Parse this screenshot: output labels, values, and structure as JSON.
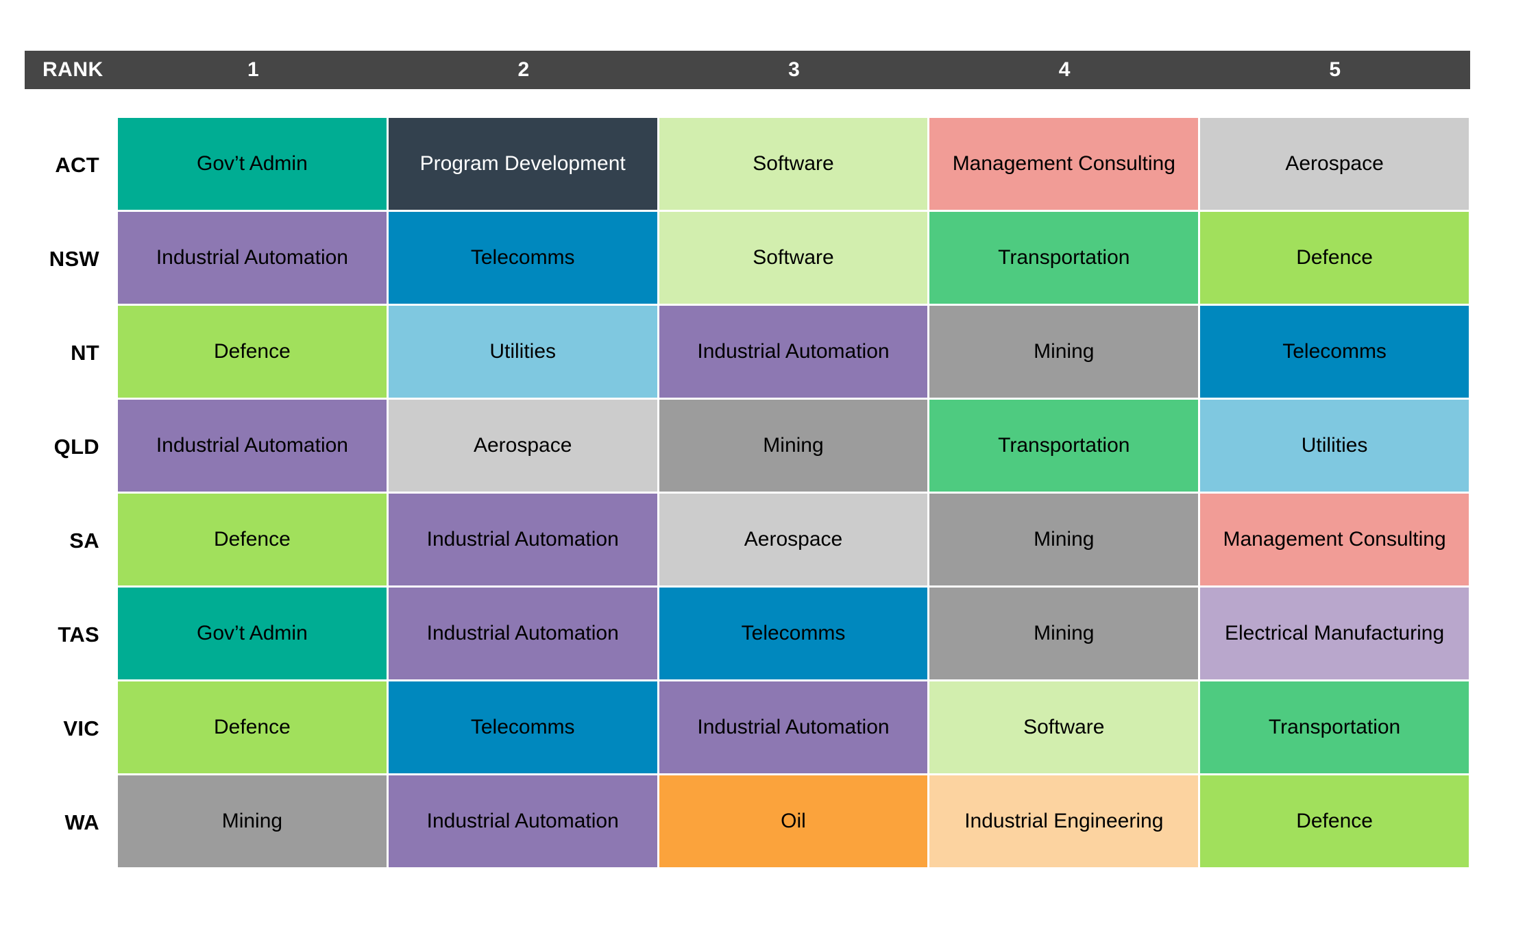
{
  "header": {
    "rank_label": "RANK",
    "columns": [
      "1",
      "2",
      "3",
      "4",
      "5"
    ],
    "background": "#464646",
    "text_color": "#ffffff"
  },
  "rows": [
    {
      "label": "ACT",
      "cells": [
        {
          "text": "Gov’t Admin",
          "color": "#00AD93",
          "text_color": "#000000"
        },
        {
          "text": "Program Development",
          "color": "#33414E",
          "text_color": "#ffffff"
        },
        {
          "text": "Software",
          "color": "#D2EEAE",
          "text_color": "#000000"
        },
        {
          "text": "Management Consulting",
          "color": "#F19C96",
          "text_color": "#000000"
        },
        {
          "text": "Aerospace",
          "color": "#CCCCCC",
          "text_color": "#000000"
        }
      ]
    },
    {
      "label": "NSW",
      "cells": [
        {
          "text": "Industrial Automation",
          "color": "#8D78B2",
          "text_color": "#000000"
        },
        {
          "text": "Telecomms",
          "color": "#0088BE",
          "text_color": "#000000"
        },
        {
          "text": "Software",
          "color": "#D2EEAE",
          "text_color": "#000000"
        },
        {
          "text": "Transportation",
          "color": "#4ECB80",
          "text_color": "#000000"
        },
        {
          "text": "Defence",
          "color": "#A1E05C",
          "text_color": "#000000"
        }
      ]
    },
    {
      "label": "NT",
      "cells": [
        {
          "text": "Defence",
          "color": "#A1E05C",
          "text_color": "#000000"
        },
        {
          "text": "Utilities",
          "color": "#7FC8E0",
          "text_color": "#000000"
        },
        {
          "text": "Industrial Automation",
          "color": "#8D78B2",
          "text_color": "#000000"
        },
        {
          "text": "Mining",
          "color": "#9C9C9C",
          "text_color": "#000000"
        },
        {
          "text": "Telecomms",
          "color": "#0088BE",
          "text_color": "#000000"
        }
      ]
    },
    {
      "label": "QLD",
      "cells": [
        {
          "text": "Industrial Automation",
          "color": "#8D78B2",
          "text_color": "#000000"
        },
        {
          "text": "Aerospace",
          "color": "#CCCCCC",
          "text_color": "#000000"
        },
        {
          "text": "Mining",
          "color": "#9C9C9C",
          "text_color": "#000000"
        },
        {
          "text": "Transportation",
          "color": "#4ECB80",
          "text_color": "#000000"
        },
        {
          "text": "Utilities",
          "color": "#7FC8E0",
          "text_color": "#000000"
        }
      ]
    },
    {
      "label": "SA",
      "cells": [
        {
          "text": "Defence",
          "color": "#A1E05C",
          "text_color": "#000000"
        },
        {
          "text": "Industrial Automation",
          "color": "#8D78B2",
          "text_color": "#000000"
        },
        {
          "text": "Aerospace",
          "color": "#CCCCCC",
          "text_color": "#000000"
        },
        {
          "text": "Mining",
          "color": "#9C9C9C",
          "text_color": "#000000"
        },
        {
          "text": "Management Consulting",
          "color": "#F19C96",
          "text_color": "#000000"
        }
      ]
    },
    {
      "label": "TAS",
      "cells": [
        {
          "text": "Gov’t Admin",
          "color": "#00AD93",
          "text_color": "#000000"
        },
        {
          "text": "Industrial Automation",
          "color": "#8D78B2",
          "text_color": "#000000"
        },
        {
          "text": "Telecomms",
          "color": "#0088BE",
          "text_color": "#000000"
        },
        {
          "text": "Mining",
          "color": "#9C9C9C",
          "text_color": "#000000"
        },
        {
          "text": "Electrical Manufacturing",
          "color": "#B9A7CC",
          "text_color": "#000000"
        }
      ]
    },
    {
      "label": "VIC",
      "cells": [
        {
          "text": "Defence",
          "color": "#A1E05C",
          "text_color": "#000000"
        },
        {
          "text": "Telecomms",
          "color": "#0088BE",
          "text_color": "#000000"
        },
        {
          "text": "Industrial Automation",
          "color": "#8D78B2",
          "text_color": "#000000"
        },
        {
          "text": "Software",
          "color": "#D2EEAE",
          "text_color": "#000000"
        },
        {
          "text": "Transportation",
          "color": "#4ECB80",
          "text_color": "#000000"
        }
      ]
    },
    {
      "label": "WA",
      "cells": [
        {
          "text": "Mining",
          "color": "#9C9C9C",
          "text_color": "#000000"
        },
        {
          "text": "Industrial Automation",
          "color": "#8D78B2",
          "text_color": "#000000"
        },
        {
          "text": "Oil",
          "color": "#FBA33C",
          "text_color": "#000000"
        },
        {
          "text": "Industrial Engineering",
          "color": "#FCD3A0",
          "text_color": "#000000"
        },
        {
          "text": "Defence",
          "color": "#A1E05C",
          "text_color": "#000000"
        }
      ]
    }
  ],
  "chart_data": {
    "type": "heatmap",
    "title": "",
    "xlabel": "RANK",
    "ylabel": "",
    "categories": [
      "1",
      "2",
      "3",
      "4",
      "5"
    ],
    "rows": [
      "ACT",
      "NSW",
      "NT",
      "QLD",
      "SA",
      "TAS",
      "VIC",
      "WA"
    ],
    "values": [
      [
        "Gov’t Admin",
        "Program Development",
        "Software",
        "Management Consulting",
        "Aerospace"
      ],
      [
        "Industrial Automation",
        "Telecomms",
        "Software",
        "Transportation",
        "Defence"
      ],
      [
        "Defence",
        "Utilities",
        "Industrial Automation",
        "Mining",
        "Telecomms"
      ],
      [
        "Industrial Automation",
        "Aerospace",
        "Mining",
        "Transportation",
        "Utilities"
      ],
      [
        "Defence",
        "Industrial Automation",
        "Aerospace",
        "Mining",
        "Management Consulting"
      ],
      [
        "Gov’t Admin",
        "Industrial Automation",
        "Telecomms",
        "Mining",
        "Electrical Manufacturing"
      ],
      [
        "Defence",
        "Telecomms",
        "Industrial Automation",
        "Software",
        "Transportation"
      ],
      [
        "Mining",
        "Industrial Automation",
        "Oil",
        "Industrial Engineering",
        "Defence"
      ]
    ],
    "category_colors": {
      "Gov’t Admin": "#00AD93",
      "Program Development": "#33414E",
      "Software": "#D2EEAE",
      "Management Consulting": "#F19C96",
      "Aerospace": "#CCCCCC",
      "Industrial Automation": "#8D78B2",
      "Telecomms": "#0088BE",
      "Transportation": "#4ECB80",
      "Defence": "#A1E05C",
      "Utilities": "#7FC8E0",
      "Mining": "#9C9C9C",
      "Electrical Manufacturing": "#B9A7CC",
      "Oil": "#FBA33C",
      "Industrial Engineering": "#FCD3A0"
    },
    "grid": false,
    "legend": "none"
  }
}
